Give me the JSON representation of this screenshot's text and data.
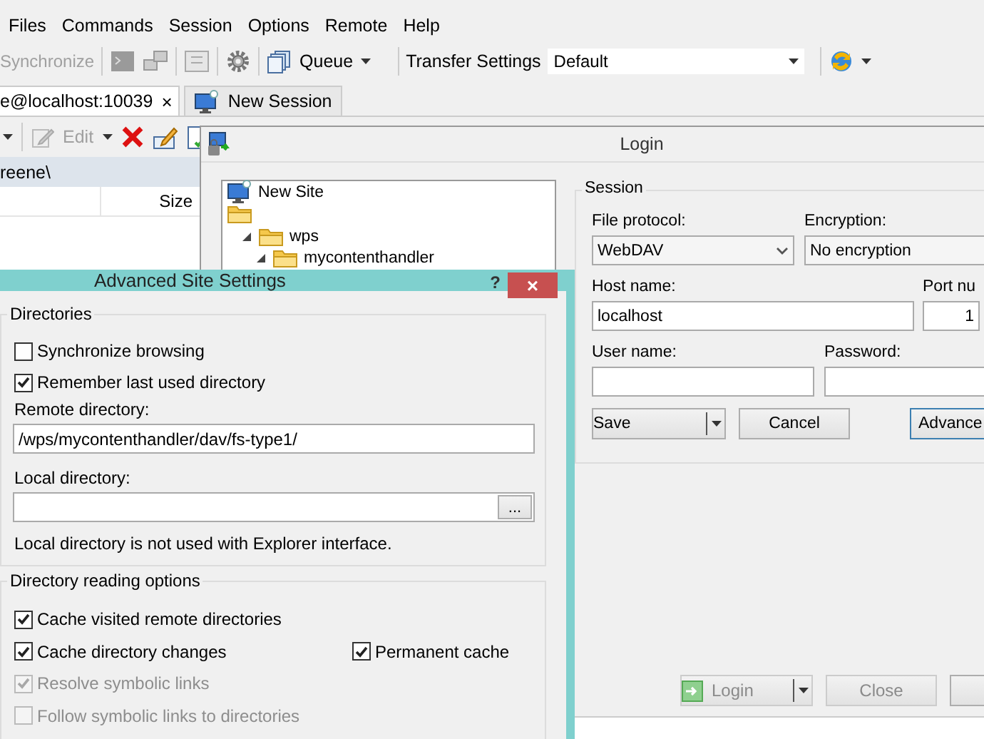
{
  "main_window": {
    "menu": [
      "Files",
      "Commands",
      "Session",
      "Options",
      "Remote",
      "Help"
    ],
    "toolbar": {
      "synchronize": "Synchronize",
      "queue": "Queue",
      "transfer_settings_label": "Transfer Settings",
      "transfer_settings_value": "Default"
    },
    "tabs": [
      {
        "label": "e@localhost:10039",
        "close": "×",
        "selected": true,
        "kind": "session"
      },
      {
        "label": "New Session",
        "selected": false,
        "kind": "new"
      }
    ],
    "file_toolbar": {
      "edit": "Edit"
    },
    "path": "reene\\",
    "columns": [
      "Size"
    ]
  },
  "login": {
    "title": "Login",
    "sites": [
      {
        "label": "New Site",
        "kind": "site"
      },
      {
        "kind": "folder",
        "children": [
          {
            "label": "wps",
            "kind": "folder",
            "expanded": true,
            "children": [
              {
                "label": "mycontenthandler",
                "kind": "folder",
                "expanded": true
              }
            ]
          }
        ]
      }
    ],
    "session": {
      "legend": "Session",
      "file_protocol": {
        "label": "File protocol:",
        "value": "WebDAV"
      },
      "encryption": {
        "label": "Encryption:",
        "value": "No encryption"
      },
      "host": {
        "label": "Host name:",
        "value": "localhost"
      },
      "port": {
        "label": "Port nu",
        "value": "1"
      },
      "user": {
        "label": "User name:"
      },
      "password": {
        "label": "Password:"
      },
      "buttons": [
        {
          "label": "Save",
          "kind": "split"
        },
        {
          "label": "Cancel",
          "kind": "plain"
        },
        {
          "label": "Advance",
          "kind": "default"
        }
      ]
    },
    "footer_buttons": [
      {
        "label": "Login",
        "kind": "split",
        "disabled": true
      },
      {
        "label": "Close",
        "kind": "plain",
        "disabled": true
      },
      {
        "kind": "blank",
        "disabled": false
      }
    ]
  },
  "advanced": {
    "title": "Advanced Site Settings",
    "help": "?",
    "close": "×",
    "directories": {
      "legend": "Directories",
      "options": [
        {
          "label": "Synchronize browsing",
          "checked": false,
          "disabled": false
        },
        {
          "label": "Remember last used directory",
          "checked": true,
          "disabled": false
        }
      ],
      "remote": {
        "label": "Remote directory:",
        "value": "/wps/mycontenthandler/dav/fs-type1/"
      },
      "local": {
        "label": "Local directory:",
        "browse": "..."
      },
      "note": "Local directory is not used with Explorer interface."
    },
    "reading": {
      "legend": "Directory reading options",
      "rows": [
        [
          {
            "label": "Cache visited remote directories",
            "checked": true,
            "disabled": false
          }
        ],
        [
          {
            "label": "Cache directory changes",
            "checked": true,
            "disabled": false
          },
          {
            "label": "Permanent cache",
            "checked": true,
            "disabled": false
          }
        ],
        [
          {
            "label": "Resolve symbolic links",
            "checked": true,
            "disabled": true
          }
        ],
        [
          {
            "label": "Follow symbolic links to directories",
            "checked": false,
            "disabled": true
          }
        ]
      ]
    }
  }
}
